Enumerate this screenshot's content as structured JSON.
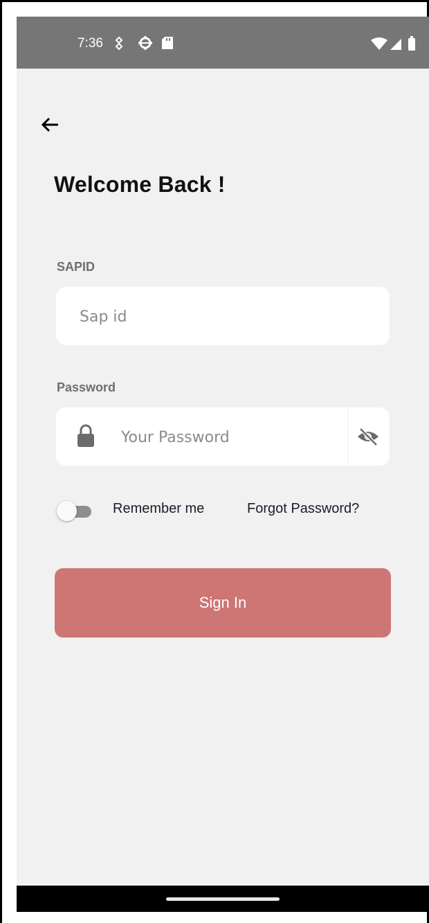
{
  "status_bar": {
    "time": "7:36",
    "left_icons": [
      "location-pin-icon",
      "settings-gear-icon",
      "sd-card-icon"
    ],
    "right_icons": [
      "wifi-icon",
      "signal-icon",
      "battery-icon"
    ]
  },
  "header": {
    "back_icon": "arrow-left-icon",
    "title": "Welcome Back !"
  },
  "form": {
    "sapid": {
      "label": "SAPID",
      "placeholder": "Sap id",
      "value": ""
    },
    "password": {
      "label": "Password",
      "placeholder": "Your Password",
      "value": "",
      "leading_icon": "lock-icon",
      "trailing_icon": "eye-off-icon"
    },
    "remember": {
      "label": "Remember me",
      "checked": false
    },
    "forgot_label": "Forgot Password?",
    "submit_label": "Sign In"
  },
  "colors": {
    "status_bar": "#767676",
    "background": "#f1f1f1",
    "button": "#cd7675",
    "button_text": "#ffffff",
    "label": "#6f6f6f"
  }
}
